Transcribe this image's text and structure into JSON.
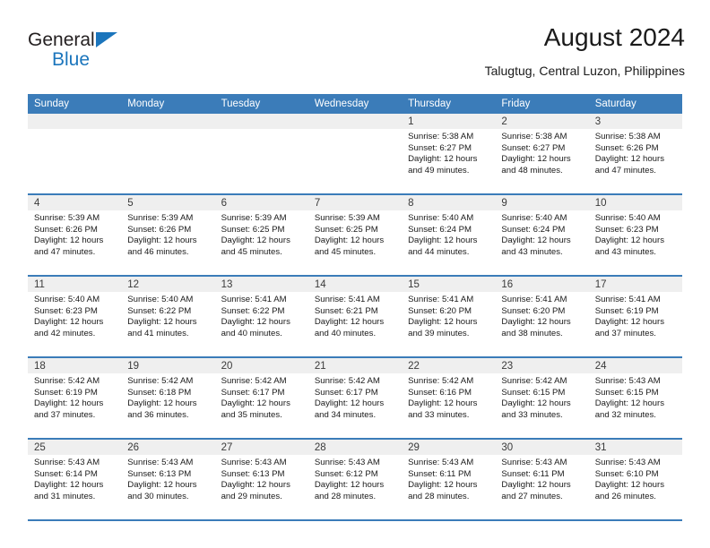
{
  "brand": {
    "name_part1": "General",
    "name_part2": "Blue",
    "triangle_color": "#1b75bc",
    "text_color": "#231f20"
  },
  "header": {
    "title": "August 2024",
    "subtitle": "Talugtug, Central Luzon, Philippines"
  },
  "theme": {
    "header_row_bg": "#3b7cb9",
    "header_row_text": "#ffffff",
    "date_band_bg": "#efefef",
    "row_divider": "#3b7cb9"
  },
  "weekday_headers": [
    "Sunday",
    "Monday",
    "Tuesday",
    "Wednesday",
    "Thursday",
    "Friday",
    "Saturday"
  ],
  "labels": {
    "sunrise_prefix": "Sunrise:",
    "sunset_prefix": "Sunset:",
    "daylight_prefix": "Daylight:"
  },
  "weeks": [
    [
      {
        "date": "",
        "empty": true
      },
      {
        "date": "",
        "empty": true
      },
      {
        "date": "",
        "empty": true
      },
      {
        "date": "",
        "empty": true
      },
      {
        "date": "1",
        "sunrise": "Sunrise: 5:38 AM",
        "sunset": "Sunset: 6:27 PM",
        "daylight": "Daylight: 12 hours and 49 minutes."
      },
      {
        "date": "2",
        "sunrise": "Sunrise: 5:38 AM",
        "sunset": "Sunset: 6:27 PM",
        "daylight": "Daylight: 12 hours and 48 minutes."
      },
      {
        "date": "3",
        "sunrise": "Sunrise: 5:38 AM",
        "sunset": "Sunset: 6:26 PM",
        "daylight": "Daylight: 12 hours and 47 minutes."
      }
    ],
    [
      {
        "date": "4",
        "sunrise": "Sunrise: 5:39 AM",
        "sunset": "Sunset: 6:26 PM",
        "daylight": "Daylight: 12 hours and 47 minutes."
      },
      {
        "date": "5",
        "sunrise": "Sunrise: 5:39 AM",
        "sunset": "Sunset: 6:26 PM",
        "daylight": "Daylight: 12 hours and 46 minutes."
      },
      {
        "date": "6",
        "sunrise": "Sunrise: 5:39 AM",
        "sunset": "Sunset: 6:25 PM",
        "daylight": "Daylight: 12 hours and 45 minutes."
      },
      {
        "date": "7",
        "sunrise": "Sunrise: 5:39 AM",
        "sunset": "Sunset: 6:25 PM",
        "daylight": "Daylight: 12 hours and 45 minutes."
      },
      {
        "date": "8",
        "sunrise": "Sunrise: 5:40 AM",
        "sunset": "Sunset: 6:24 PM",
        "daylight": "Daylight: 12 hours and 44 minutes."
      },
      {
        "date": "9",
        "sunrise": "Sunrise: 5:40 AM",
        "sunset": "Sunset: 6:24 PM",
        "daylight": "Daylight: 12 hours and 43 minutes."
      },
      {
        "date": "10",
        "sunrise": "Sunrise: 5:40 AM",
        "sunset": "Sunset: 6:23 PM",
        "daylight": "Daylight: 12 hours and 43 minutes."
      }
    ],
    [
      {
        "date": "11",
        "sunrise": "Sunrise: 5:40 AM",
        "sunset": "Sunset: 6:23 PM",
        "daylight": "Daylight: 12 hours and 42 minutes."
      },
      {
        "date": "12",
        "sunrise": "Sunrise: 5:40 AM",
        "sunset": "Sunset: 6:22 PM",
        "daylight": "Daylight: 12 hours and 41 minutes."
      },
      {
        "date": "13",
        "sunrise": "Sunrise: 5:41 AM",
        "sunset": "Sunset: 6:22 PM",
        "daylight": "Daylight: 12 hours and 40 minutes."
      },
      {
        "date": "14",
        "sunrise": "Sunrise: 5:41 AM",
        "sunset": "Sunset: 6:21 PM",
        "daylight": "Daylight: 12 hours and 40 minutes."
      },
      {
        "date": "15",
        "sunrise": "Sunrise: 5:41 AM",
        "sunset": "Sunset: 6:20 PM",
        "daylight": "Daylight: 12 hours and 39 minutes."
      },
      {
        "date": "16",
        "sunrise": "Sunrise: 5:41 AM",
        "sunset": "Sunset: 6:20 PM",
        "daylight": "Daylight: 12 hours and 38 minutes."
      },
      {
        "date": "17",
        "sunrise": "Sunrise: 5:41 AM",
        "sunset": "Sunset: 6:19 PM",
        "daylight": "Daylight: 12 hours and 37 minutes."
      }
    ],
    [
      {
        "date": "18",
        "sunrise": "Sunrise: 5:42 AM",
        "sunset": "Sunset: 6:19 PM",
        "daylight": "Daylight: 12 hours and 37 minutes."
      },
      {
        "date": "19",
        "sunrise": "Sunrise: 5:42 AM",
        "sunset": "Sunset: 6:18 PM",
        "daylight": "Daylight: 12 hours and 36 minutes."
      },
      {
        "date": "20",
        "sunrise": "Sunrise: 5:42 AM",
        "sunset": "Sunset: 6:17 PM",
        "daylight": "Daylight: 12 hours and 35 minutes."
      },
      {
        "date": "21",
        "sunrise": "Sunrise: 5:42 AM",
        "sunset": "Sunset: 6:17 PM",
        "daylight": "Daylight: 12 hours and 34 minutes."
      },
      {
        "date": "22",
        "sunrise": "Sunrise: 5:42 AM",
        "sunset": "Sunset: 6:16 PM",
        "daylight": "Daylight: 12 hours and 33 minutes."
      },
      {
        "date": "23",
        "sunrise": "Sunrise: 5:42 AM",
        "sunset": "Sunset: 6:15 PM",
        "daylight": "Daylight: 12 hours and 33 minutes."
      },
      {
        "date": "24",
        "sunrise": "Sunrise: 5:43 AM",
        "sunset": "Sunset: 6:15 PM",
        "daylight": "Daylight: 12 hours and 32 minutes."
      }
    ],
    [
      {
        "date": "25",
        "sunrise": "Sunrise: 5:43 AM",
        "sunset": "Sunset: 6:14 PM",
        "daylight": "Daylight: 12 hours and 31 minutes."
      },
      {
        "date": "26",
        "sunrise": "Sunrise: 5:43 AM",
        "sunset": "Sunset: 6:13 PM",
        "daylight": "Daylight: 12 hours and 30 minutes."
      },
      {
        "date": "27",
        "sunrise": "Sunrise: 5:43 AM",
        "sunset": "Sunset: 6:13 PM",
        "daylight": "Daylight: 12 hours and 29 minutes."
      },
      {
        "date": "28",
        "sunrise": "Sunrise: 5:43 AM",
        "sunset": "Sunset: 6:12 PM",
        "daylight": "Daylight: 12 hours and 28 minutes."
      },
      {
        "date": "29",
        "sunrise": "Sunrise: 5:43 AM",
        "sunset": "Sunset: 6:11 PM",
        "daylight": "Daylight: 12 hours and 28 minutes."
      },
      {
        "date": "30",
        "sunrise": "Sunrise: 5:43 AM",
        "sunset": "Sunset: 6:11 PM",
        "daylight": "Daylight: 12 hours and 27 minutes."
      },
      {
        "date": "31",
        "sunrise": "Sunrise: 5:43 AM",
        "sunset": "Sunset: 6:10 PM",
        "daylight": "Daylight: 12 hours and 26 minutes."
      }
    ]
  ]
}
